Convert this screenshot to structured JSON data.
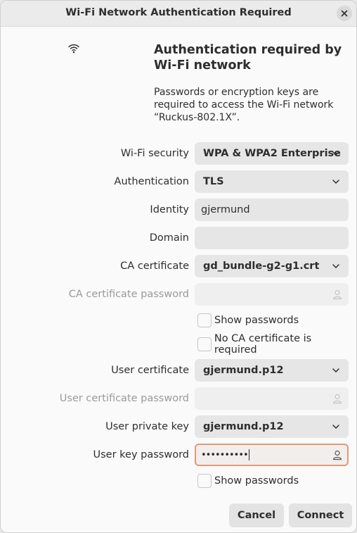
{
  "window": {
    "title": "Wi-Fi Network Authentication Required"
  },
  "header": {
    "heading": "Authentication required by Wi-Fi network",
    "description": "Passwords or encryption keys are required to access the Wi-Fi network “Ruckus-802.1X”."
  },
  "form": {
    "wifi_security": {
      "label": "Wi-Fi security",
      "value": "WPA & WPA2 Enterprise"
    },
    "authentication": {
      "label": "Authentication",
      "value": "TLS"
    },
    "identity": {
      "label": "Identity",
      "value": "gjermund"
    },
    "domain": {
      "label": "Domain",
      "value": ""
    },
    "ca_certificate": {
      "label": "CA certificate",
      "value": "gd_bundle-g2-g1.crt"
    },
    "ca_certificate_password": {
      "label": "CA certificate password",
      "value": ""
    },
    "show_passwords_1": {
      "label": "Show passwords",
      "checked": false
    },
    "no_ca_required": {
      "label": "No CA certificate is required",
      "checked": false
    },
    "user_certificate": {
      "label": "User certificate",
      "value": "gjermund.p12"
    },
    "user_certificate_password": {
      "label": "User certificate password",
      "value": ""
    },
    "user_private_key": {
      "label": "User private key",
      "value": "gjermund.p12"
    },
    "user_key_password": {
      "label": "User key password",
      "value": "••••••••••"
    },
    "show_passwords_2": {
      "label": "Show passwords",
      "checked": false
    }
  },
  "buttons": {
    "cancel": "Cancel",
    "connect": "Connect"
  },
  "icons": {
    "close": "close-icon",
    "wifi": "wifi-icon",
    "dropdown": "chevron-down-icon",
    "password_owner": "person-icon"
  },
  "colors": {
    "focus_border": "#e09a78",
    "field_bg": "#e6e6e6"
  }
}
